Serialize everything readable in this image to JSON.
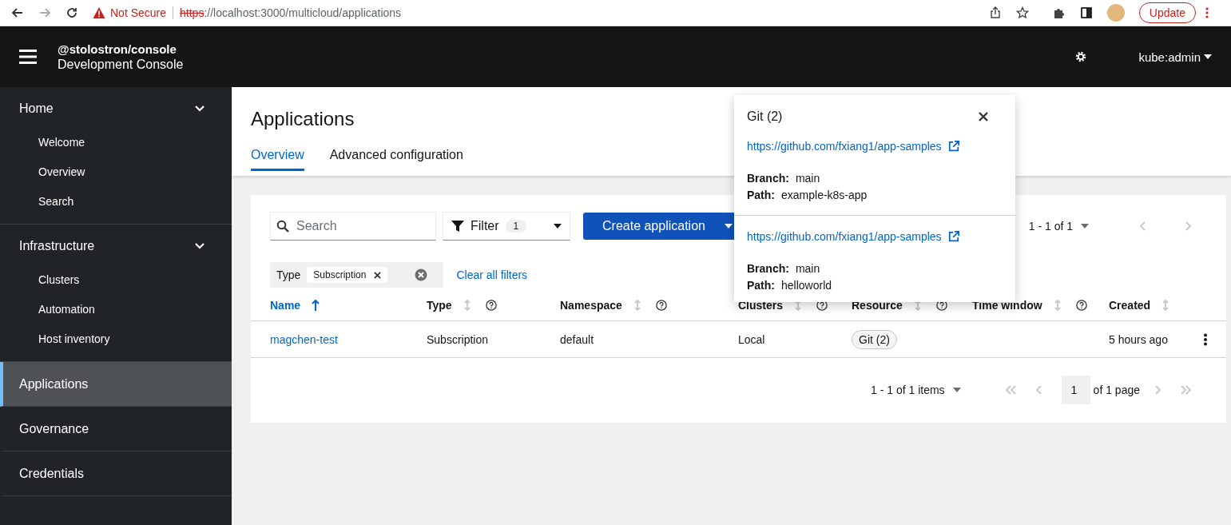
{
  "browser": {
    "security": "Not Secure",
    "url_scheme": "https",
    "url_rest": "://localhost:3000/multicloud/applications",
    "update": "Update"
  },
  "masthead": {
    "title": "@stolostron/console",
    "subtitle": "Development Console",
    "user": "kube:admin"
  },
  "sidebar": {
    "items": [
      {
        "kind": "group",
        "label": "Home",
        "selected": false,
        "expanded": true,
        "children": [
          {
            "label": "Welcome",
            "selected": false
          },
          {
            "label": "Overview",
            "selected": false
          },
          {
            "label": "Search",
            "selected": false
          }
        ]
      },
      {
        "kind": "group",
        "label": "Infrastructure",
        "selected": false,
        "expanded": true,
        "children": [
          {
            "label": "Clusters",
            "selected": false
          },
          {
            "label": "Automation",
            "selected": false
          },
          {
            "label": "Host inventory",
            "selected": false
          }
        ]
      },
      {
        "kind": "link",
        "label": "Applications",
        "selected": true
      },
      {
        "kind": "link",
        "label": "Governance",
        "selected": false
      },
      {
        "kind": "link",
        "label": "Credentials",
        "selected": false
      }
    ]
  },
  "page": {
    "title": "Applications",
    "tabs": [
      {
        "label": "Overview",
        "selected": true
      },
      {
        "label": "Advanced configuration",
        "selected": false
      }
    ]
  },
  "toolbar": {
    "search": {
      "placeholder": "Search"
    },
    "filter": {
      "label": "Filter",
      "count": "1"
    },
    "create": "Create application",
    "pagination": "1 - 1 of 1"
  },
  "filters": {
    "group": "Type",
    "chips": [
      "Subscription"
    ],
    "clear": "Clear all filters"
  },
  "table": {
    "columns": [
      {
        "label": "Name",
        "sorted": true,
        "help": false
      },
      {
        "label": "Type",
        "sorted": false,
        "help": true
      },
      {
        "label": "Namespace",
        "sorted": false,
        "help": true
      },
      {
        "label": "Clusters",
        "sorted": false,
        "help": true
      },
      {
        "label": "Resource",
        "sorted": false,
        "help": true
      },
      {
        "label": "Time window",
        "sorted": false,
        "help": true
      },
      {
        "label": "Created",
        "sorted": false,
        "help": false
      }
    ],
    "rows": [
      {
        "name": "magchen-test",
        "type": "Subscription",
        "namespace": "default",
        "clusters": "Local",
        "resource": "Git (2)",
        "created": "5 hours ago"
      }
    ]
  },
  "footer": {
    "range": "1 - 1 of 1 items",
    "page": "1",
    "of_pages": "of 1 page"
  },
  "popover": {
    "title": "Git (2)",
    "repos": [
      {
        "url": "https://github.com/fxiang1/app-samples",
        "branch_label": "Branch:",
        "branch": "main",
        "path_label": "Path:",
        "path": "example-k8s-app"
      },
      {
        "url": "https://github.com/fxiang1/app-samples",
        "branch_label": "Branch:",
        "branch": "main",
        "path_label": "Path:",
        "path": "helloworld"
      }
    ]
  }
}
